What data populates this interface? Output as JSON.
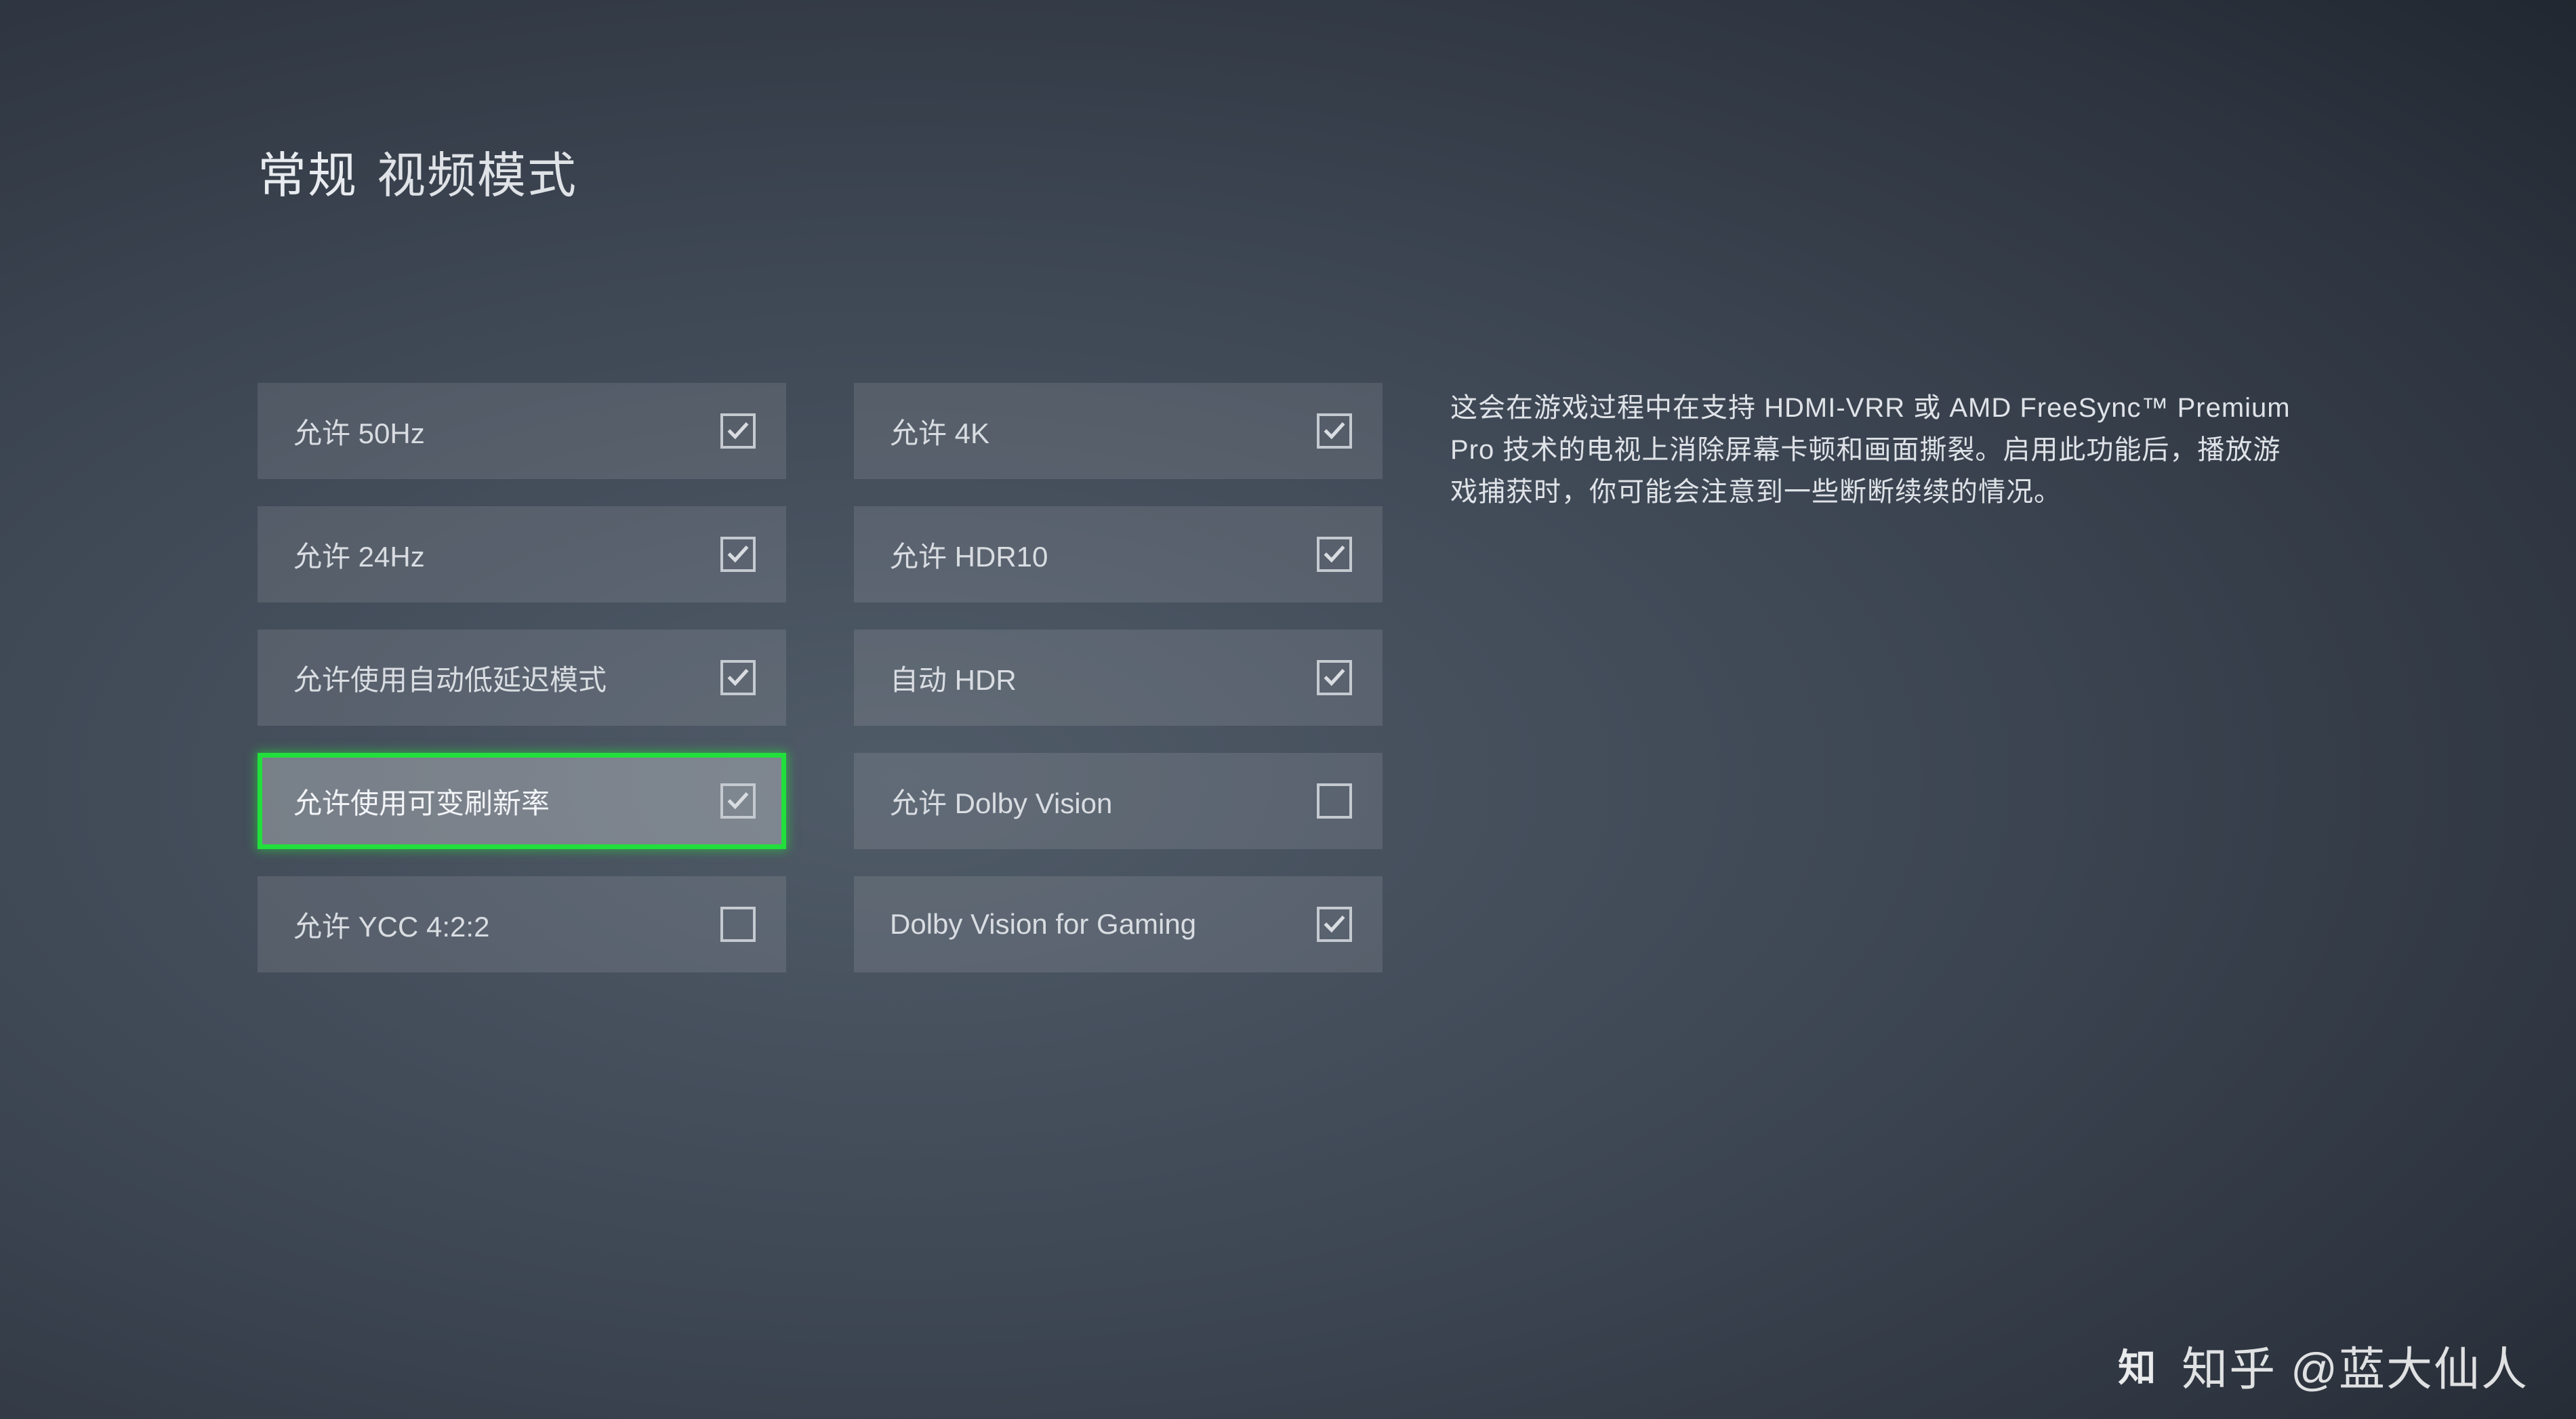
{
  "title": {
    "primary": "常规",
    "secondary": "视频模式"
  },
  "columns": [
    [
      {
        "id": "allow-50hz",
        "label": "允许 50Hz",
        "checked": true,
        "selected": false
      },
      {
        "id": "allow-24hz",
        "label": "允许 24Hz",
        "checked": true,
        "selected": false
      },
      {
        "id": "allow-allm",
        "label": "允许使用自动低延迟模式",
        "checked": true,
        "selected": false
      },
      {
        "id": "allow-vrr",
        "label": "允许使用可变刷新率",
        "checked": true,
        "selected": true
      },
      {
        "id": "allow-ycc422",
        "label": "允许 YCC 4:2:2",
        "checked": false,
        "selected": false
      }
    ],
    [
      {
        "id": "allow-4k",
        "label": "允许 4K",
        "checked": true,
        "selected": false
      },
      {
        "id": "allow-hdr10",
        "label": "允许 HDR10",
        "checked": true,
        "selected": false
      },
      {
        "id": "auto-hdr",
        "label": "自动 HDR",
        "checked": true,
        "selected": false
      },
      {
        "id": "allow-dolbyvision",
        "label": "允许 Dolby Vision",
        "checked": false,
        "selected": false
      },
      {
        "id": "dv-gaming",
        "label": "Dolby Vision for Gaming",
        "checked": true,
        "selected": false
      }
    ]
  ],
  "description": "这会在游戏过程中在支持 HDMI-VRR 或 AMD FreeSync™ Premium Pro 技术的电视上消除屏幕卡顿和画面撕裂。启用此功能后，播放游戏捕获时，你可能会注意到一些断断续续的情况。",
  "watermark": {
    "logo": "知",
    "text": "知乎 @蓝大仙人"
  },
  "colors": {
    "accent": "#22e03c"
  }
}
